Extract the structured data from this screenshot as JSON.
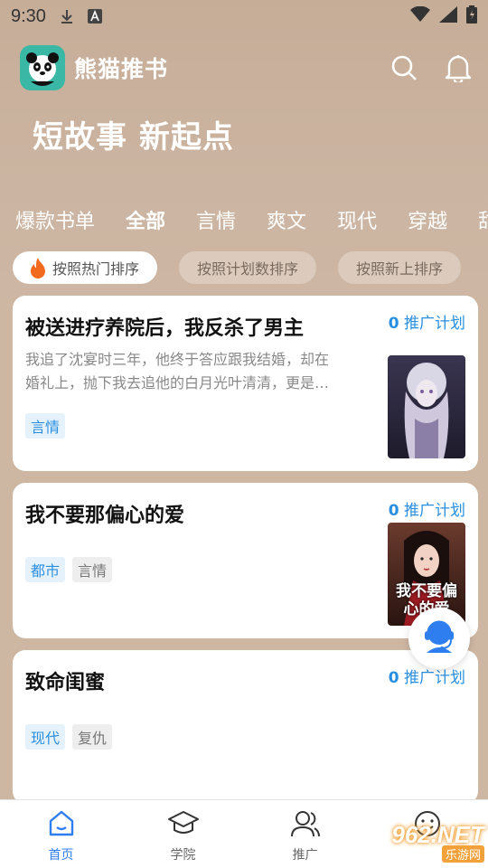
{
  "status_bar": {
    "time": "9:30"
  },
  "header": {
    "app_name": "熊猫推书",
    "slogan": "短故事 新起点"
  },
  "category_tabs": [
    {
      "label": "爆款书单",
      "active": false
    },
    {
      "label": "全部",
      "active": true
    },
    {
      "label": "言情",
      "active": false
    },
    {
      "label": "爽文",
      "active": false
    },
    {
      "label": "现代",
      "active": false
    },
    {
      "label": "穿越",
      "active": false
    },
    {
      "label": "甜",
      "active": false
    }
  ],
  "sort_options": [
    {
      "label": "按照热门排序",
      "active": true
    },
    {
      "label": "按照计划数排序",
      "active": false
    },
    {
      "label": "按照新上排序",
      "active": false
    }
  ],
  "books": [
    {
      "title": "被送进疗养院后，我反杀了男主",
      "promo_count": "0",
      "promo_label": "推广计划",
      "description": "我追了沈宴时三年，他终于答应跟我结婚，却在婚礼上，抛下我去追他的白月光叶清清，更是…",
      "tags": [
        {
          "label": "言情",
          "style": "blue"
        }
      ]
    },
    {
      "title": "我不要那偏心的爱",
      "promo_count": "0",
      "promo_label": "推广计划",
      "description": "",
      "cover_text": "我不要偏心的爱",
      "tags": [
        {
          "label": "都市",
          "style": "blue"
        },
        {
          "label": "言情",
          "style": "gray"
        }
      ]
    },
    {
      "title": "致命闺蜜",
      "promo_count": "0",
      "promo_label": "推广计划",
      "description": "",
      "tags": [
        {
          "label": "现代",
          "style": "blue"
        },
        {
          "label": "复仇",
          "style": "gray"
        }
      ]
    }
  ],
  "bottom_nav": [
    {
      "label": "首页",
      "icon": "home-icon",
      "active": true
    },
    {
      "label": "学院",
      "icon": "graduation-cap-icon",
      "active": false
    },
    {
      "label": "推广",
      "icon": "users-icon",
      "active": false
    },
    {
      "label": "",
      "icon": "smile-icon",
      "active": false
    }
  ],
  "watermark": {
    "main": "962.NET",
    "sub": "乐游网"
  },
  "colors": {
    "accent": "#2f7ef0",
    "promo": "#2a8fe0",
    "header_bg": "#c9b19d"
  }
}
